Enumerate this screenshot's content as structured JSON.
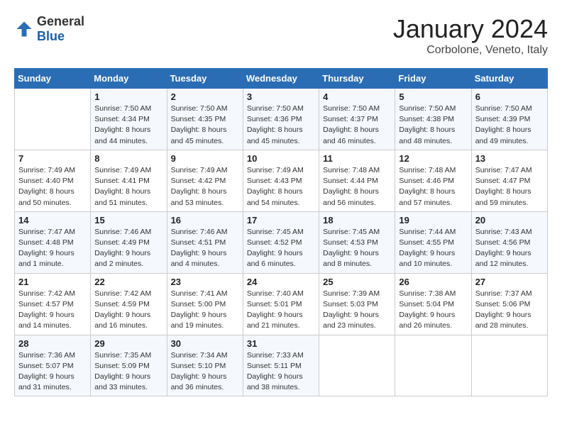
{
  "header": {
    "logo": {
      "general": "General",
      "blue": "Blue"
    },
    "title": "January 2024",
    "location": "Corbolone, Veneto, Italy"
  },
  "days_of_week": [
    "Sunday",
    "Monday",
    "Tuesday",
    "Wednesday",
    "Thursday",
    "Friday",
    "Saturday"
  ],
  "weeks": [
    [
      {
        "day": "",
        "info": ""
      },
      {
        "day": "1",
        "info": "Sunrise: 7:50 AM\nSunset: 4:34 PM\nDaylight: 8 hours\nand 44 minutes."
      },
      {
        "day": "2",
        "info": "Sunrise: 7:50 AM\nSunset: 4:35 PM\nDaylight: 8 hours\nand 45 minutes."
      },
      {
        "day": "3",
        "info": "Sunrise: 7:50 AM\nSunset: 4:36 PM\nDaylight: 8 hours\nand 45 minutes."
      },
      {
        "day": "4",
        "info": "Sunrise: 7:50 AM\nSunset: 4:37 PM\nDaylight: 8 hours\nand 46 minutes."
      },
      {
        "day": "5",
        "info": "Sunrise: 7:50 AM\nSunset: 4:38 PM\nDaylight: 8 hours\nand 48 minutes."
      },
      {
        "day": "6",
        "info": "Sunrise: 7:50 AM\nSunset: 4:39 PM\nDaylight: 8 hours\nand 49 minutes."
      }
    ],
    [
      {
        "day": "7",
        "info": "Sunrise: 7:49 AM\nSunset: 4:40 PM\nDaylight: 8 hours\nand 50 minutes."
      },
      {
        "day": "8",
        "info": "Sunrise: 7:49 AM\nSunset: 4:41 PM\nDaylight: 8 hours\nand 51 minutes."
      },
      {
        "day": "9",
        "info": "Sunrise: 7:49 AM\nSunset: 4:42 PM\nDaylight: 8 hours\nand 53 minutes."
      },
      {
        "day": "10",
        "info": "Sunrise: 7:49 AM\nSunset: 4:43 PM\nDaylight: 8 hours\nand 54 minutes."
      },
      {
        "day": "11",
        "info": "Sunrise: 7:48 AM\nSunset: 4:44 PM\nDaylight: 8 hours\nand 56 minutes."
      },
      {
        "day": "12",
        "info": "Sunrise: 7:48 AM\nSunset: 4:46 PM\nDaylight: 8 hours\nand 57 minutes."
      },
      {
        "day": "13",
        "info": "Sunrise: 7:47 AM\nSunset: 4:47 PM\nDaylight: 8 hours\nand 59 minutes."
      }
    ],
    [
      {
        "day": "14",
        "info": "Sunrise: 7:47 AM\nSunset: 4:48 PM\nDaylight: 9 hours\nand 1 minute."
      },
      {
        "day": "15",
        "info": "Sunrise: 7:46 AM\nSunset: 4:49 PM\nDaylight: 9 hours\nand 2 minutes."
      },
      {
        "day": "16",
        "info": "Sunrise: 7:46 AM\nSunset: 4:51 PM\nDaylight: 9 hours\nand 4 minutes."
      },
      {
        "day": "17",
        "info": "Sunrise: 7:45 AM\nSunset: 4:52 PM\nDaylight: 9 hours\nand 6 minutes."
      },
      {
        "day": "18",
        "info": "Sunrise: 7:45 AM\nSunset: 4:53 PM\nDaylight: 9 hours\nand 8 minutes."
      },
      {
        "day": "19",
        "info": "Sunrise: 7:44 AM\nSunset: 4:55 PM\nDaylight: 9 hours\nand 10 minutes."
      },
      {
        "day": "20",
        "info": "Sunrise: 7:43 AM\nSunset: 4:56 PM\nDaylight: 9 hours\nand 12 minutes."
      }
    ],
    [
      {
        "day": "21",
        "info": "Sunrise: 7:42 AM\nSunset: 4:57 PM\nDaylight: 9 hours\nand 14 minutes."
      },
      {
        "day": "22",
        "info": "Sunrise: 7:42 AM\nSunset: 4:59 PM\nDaylight: 9 hours\nand 16 minutes."
      },
      {
        "day": "23",
        "info": "Sunrise: 7:41 AM\nSunset: 5:00 PM\nDaylight: 9 hours\nand 19 minutes."
      },
      {
        "day": "24",
        "info": "Sunrise: 7:40 AM\nSunset: 5:01 PM\nDaylight: 9 hours\nand 21 minutes."
      },
      {
        "day": "25",
        "info": "Sunrise: 7:39 AM\nSunset: 5:03 PM\nDaylight: 9 hours\nand 23 minutes."
      },
      {
        "day": "26",
        "info": "Sunrise: 7:38 AM\nSunset: 5:04 PM\nDaylight: 9 hours\nand 26 minutes."
      },
      {
        "day": "27",
        "info": "Sunrise: 7:37 AM\nSunset: 5:06 PM\nDaylight: 9 hours\nand 28 minutes."
      }
    ],
    [
      {
        "day": "28",
        "info": "Sunrise: 7:36 AM\nSunset: 5:07 PM\nDaylight: 9 hours\nand 31 minutes."
      },
      {
        "day": "29",
        "info": "Sunrise: 7:35 AM\nSunset: 5:09 PM\nDaylight: 9 hours\nand 33 minutes."
      },
      {
        "day": "30",
        "info": "Sunrise: 7:34 AM\nSunset: 5:10 PM\nDaylight: 9 hours\nand 36 minutes."
      },
      {
        "day": "31",
        "info": "Sunrise: 7:33 AM\nSunset: 5:11 PM\nDaylight: 9 hours\nand 38 minutes."
      },
      {
        "day": "",
        "info": ""
      },
      {
        "day": "",
        "info": ""
      },
      {
        "day": "",
        "info": ""
      }
    ]
  ]
}
